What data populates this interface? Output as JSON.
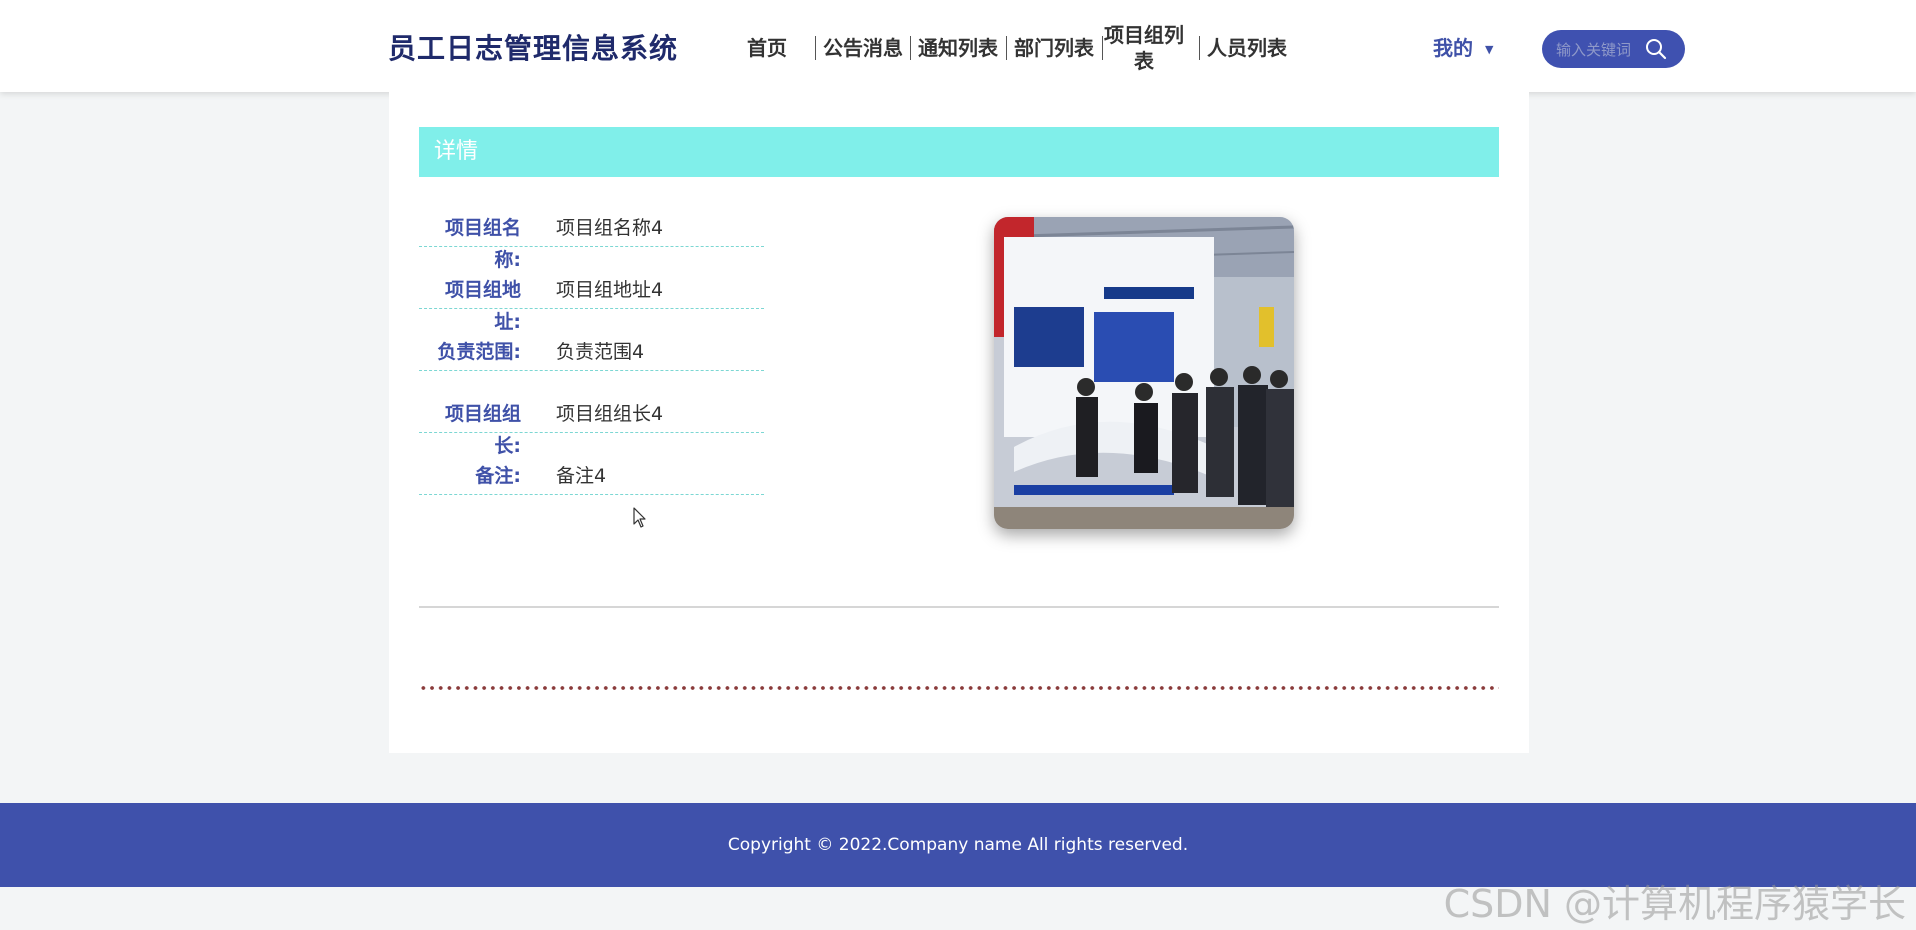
{
  "header": {
    "brand": "员工日志管理信息系统",
    "nav": [
      "首页",
      "公告消息",
      "通知列表",
      "部门列表",
      "项目组列表",
      "人员列表"
    ],
    "me": "我的",
    "search_placeholder": "输入关键词"
  },
  "detail": {
    "section_title": "详情",
    "fields": [
      {
        "label": "项目组名称:",
        "value": "项目组名称4"
      },
      {
        "label": "项目组地址:",
        "value": "项目组地址4"
      },
      {
        "label": "负责范围:",
        "value": "负责范围4"
      },
      {
        "label": "项目组组长:",
        "value": "项目组组长4"
      },
      {
        "label": "备注:",
        "value": "备注4"
      }
    ]
  },
  "footer": {
    "copyright": "Copyright © 2022.Company name All rights reserved."
  },
  "watermark": "CSDN @计算机程序猿学长",
  "colors": {
    "primary": "#3f51ab",
    "title_bar": "#80efea",
    "label": "#3f51a8"
  }
}
